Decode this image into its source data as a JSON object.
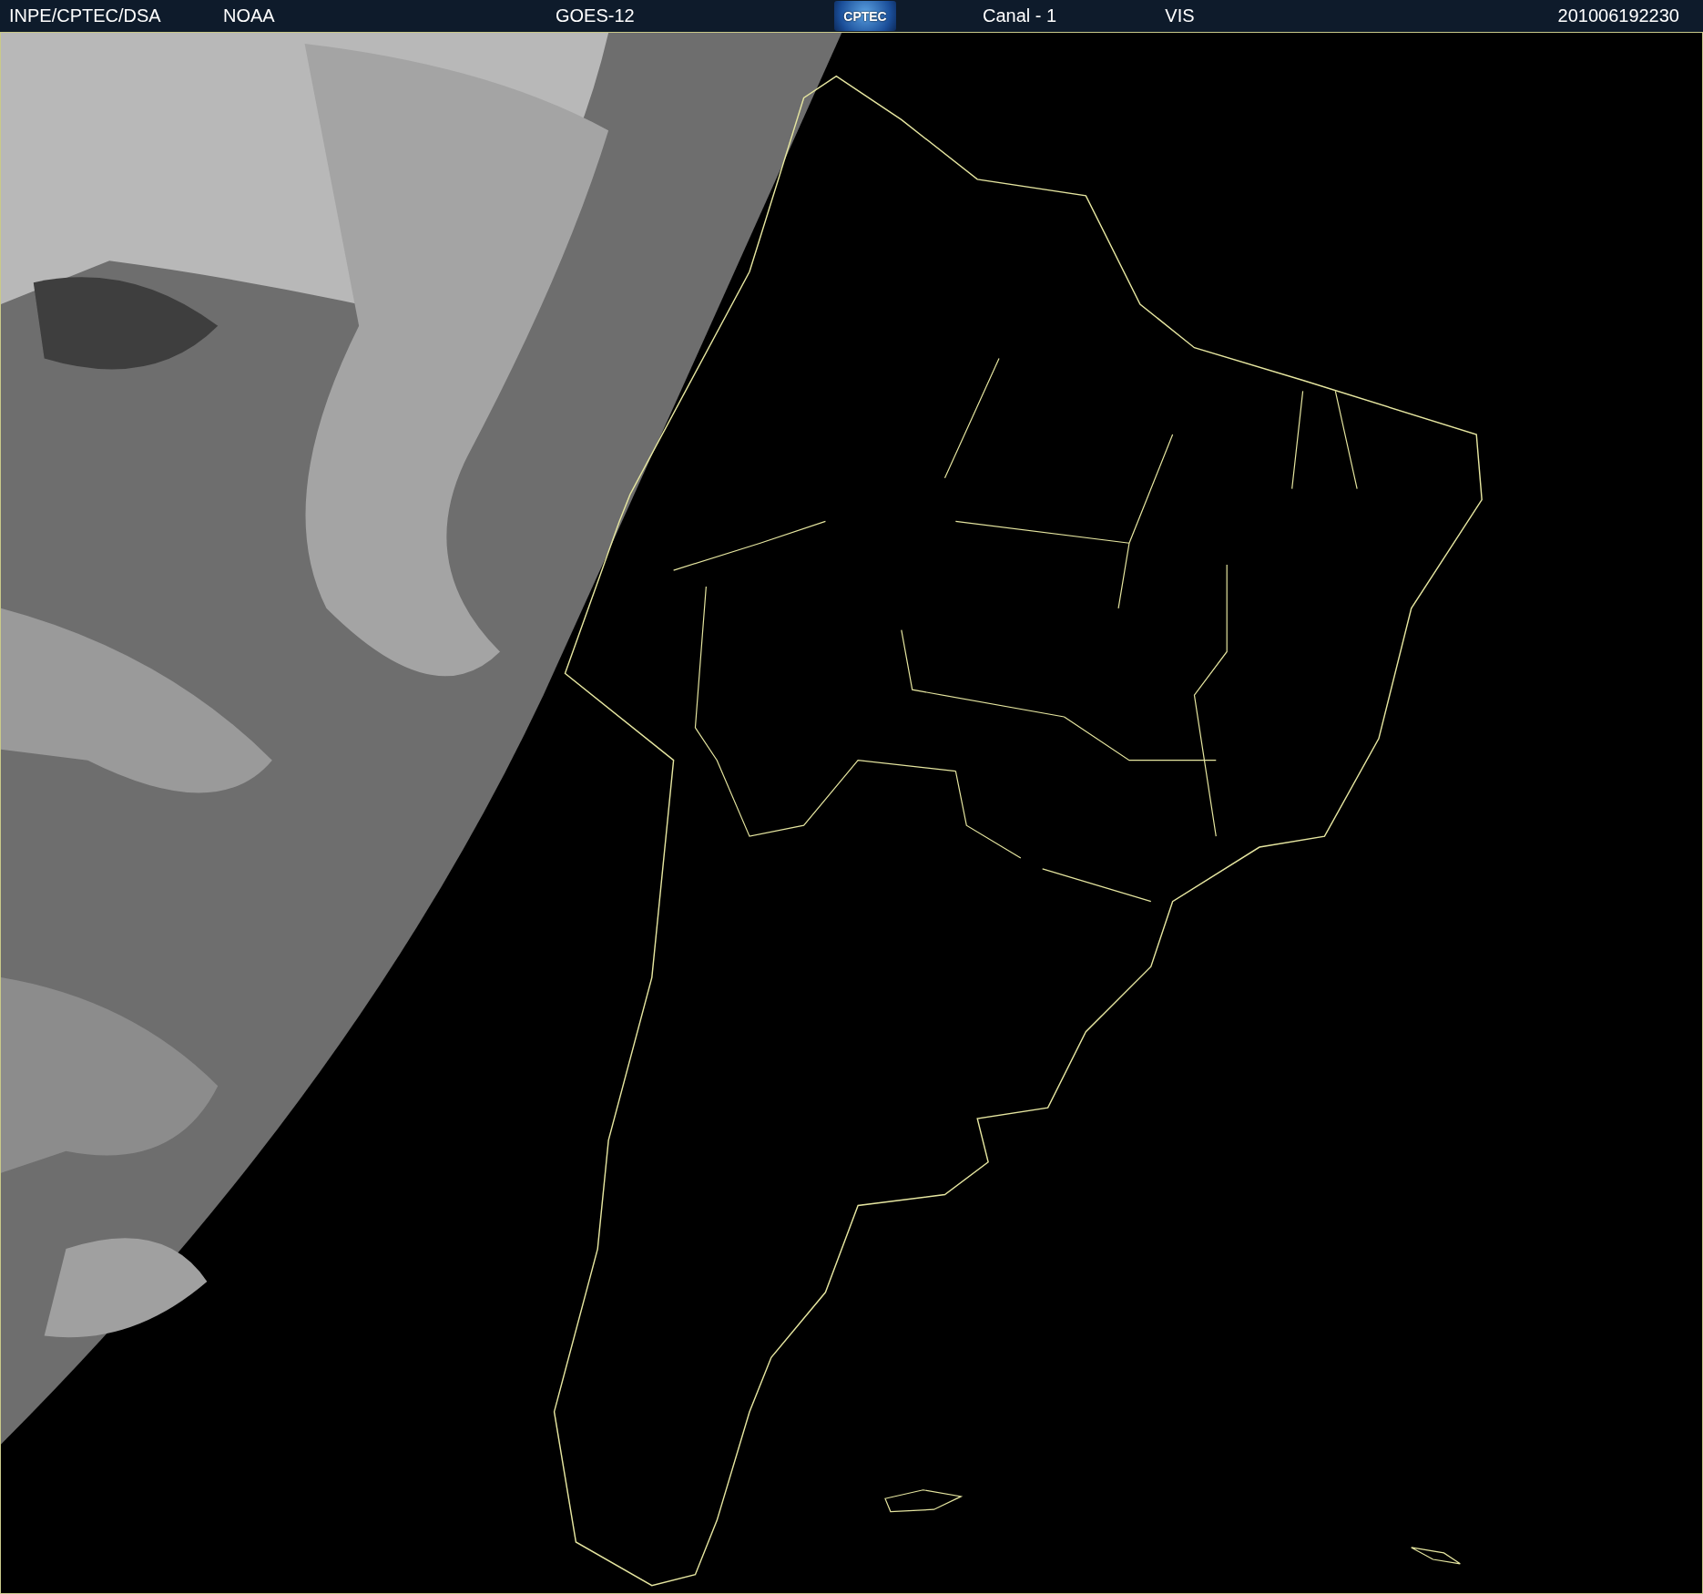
{
  "header": {
    "items": [
      {
        "kind": "text",
        "text": "INPE/CPTEC/DSA"
      },
      {
        "kind": "text",
        "text": "NOAA"
      },
      {
        "kind": "text",
        "text": "GOES-12"
      },
      {
        "kind": "logo",
        "text": "CPTEC"
      },
      {
        "kind": "text",
        "text": "Canal - 1"
      },
      {
        "kind": "text",
        "text": "VIS"
      },
      {
        "kind": "text",
        "text": "201006192230"
      }
    ]
  }
}
